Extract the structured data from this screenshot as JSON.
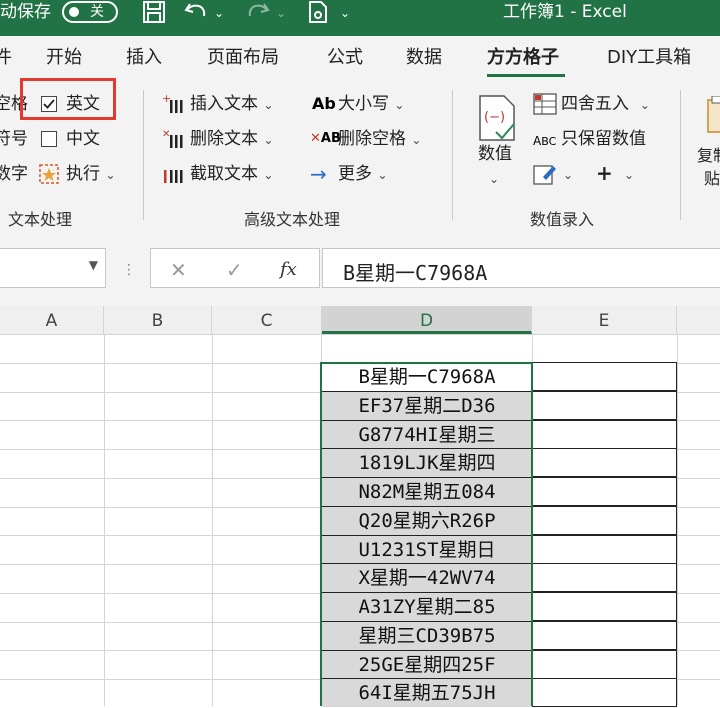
{
  "titlebar": {
    "autosave_label": "动保存",
    "autosave_state": "关",
    "doc_title": "工作簿1  -  Excel"
  },
  "tabs": [
    {
      "label": "件"
    },
    {
      "label": "开始"
    },
    {
      "label": "插入"
    },
    {
      "label": "页面布局"
    },
    {
      "label": "公式"
    },
    {
      "label": "数据"
    },
    {
      "label": "方方格子"
    },
    {
      "label": "DIY工具箱"
    }
  ],
  "ribbon": {
    "text_group": {
      "cut_items": [
        "空格",
        "符号",
        "数字"
      ],
      "english_label": "英文",
      "chinese_label": "中文",
      "execute_label": "执行",
      "group_name": "文本处理"
    },
    "adv_group": {
      "insert_label": "插入文本",
      "delete_label": "删除文本",
      "extract_label": "截取文本",
      "case_label": "大小写",
      "remove_space_label": "删除空格",
      "more_label": "更多",
      "group_name": "高级文本处理"
    },
    "num_group": {
      "value_label": "数值",
      "round_label": "四舍五入",
      "keep_value_label": "只保留数值",
      "plus_label": "+",
      "group_name": "数值录入"
    },
    "clip_group": {
      "label_top": "复制",
      "label_bottom": "贴"
    }
  },
  "formula_bar": {
    "cancel_symbol": "✕",
    "enter_symbol": "✓",
    "fx_symbol": "fx",
    "value": "B星期一C7968A"
  },
  "columns": [
    "A",
    "B",
    "C",
    "D",
    "E"
  ],
  "cells_d": [
    "B星期一C7968A",
    "EF37星期二D36",
    "G8774HI星期三",
    "1819LJK星期四",
    "N82M星期五084",
    "Q20星期六R26P",
    "U1231ST星期日",
    "X星期一42WV74",
    "A31ZY星期二85",
    "星期三CD39B75",
    "25GE星期四25F",
    "64I星期五75JH"
  ]
}
